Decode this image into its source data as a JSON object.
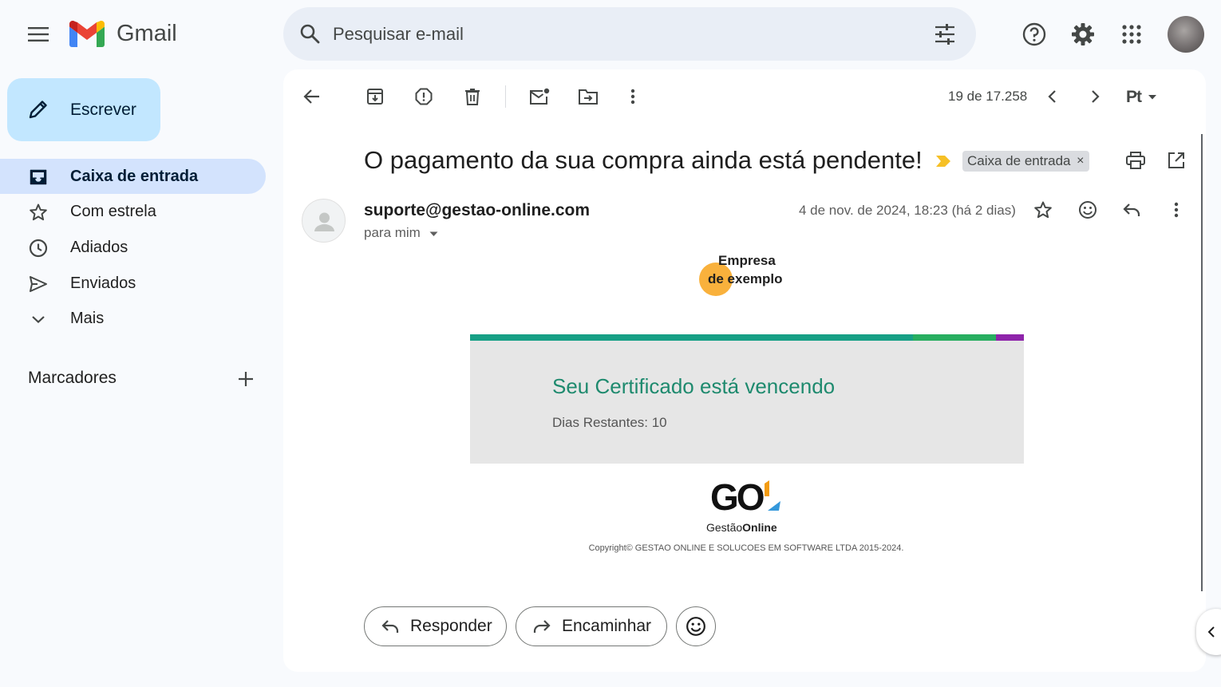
{
  "header": {
    "app_name": "Gmail",
    "search_placeholder": "Pesquisar e-mail"
  },
  "sidebar": {
    "compose_label": "Escrever",
    "items": [
      {
        "label": "Caixa de entrada",
        "icon": "inbox-icon",
        "active": true
      },
      {
        "label": "Com estrela",
        "icon": "star-icon"
      },
      {
        "label": "Adiados",
        "icon": "clock-icon"
      },
      {
        "label": "Enviados",
        "icon": "send-icon"
      },
      {
        "label": "Mais",
        "icon": "chevron-down-icon"
      }
    ],
    "labels_title": "Marcadores"
  },
  "toolbar": {
    "pagination": "19 de 17.258",
    "input_tool": "Pt"
  },
  "message": {
    "subject": "O pagamento da sua compra ainda está pendente!",
    "label_tag": "Caixa de entrada",
    "label_tag_close": "×",
    "sender": "suporte@gestao-online.com",
    "recipient": "para mim",
    "date": "4 de nov. de 2024, 18:23 (há 2 dias)"
  },
  "email_body": {
    "logo_line1": "Empresa",
    "logo_line2": "de exemplo",
    "card_title": "Seu Certificado está vencendo",
    "card_days": "Dias Restantes: 10",
    "footer_logo_text": "GO",
    "footer_logo_sub_a": "Gestão",
    "footer_logo_sub_b": "Online",
    "copyright": "Copyright© GESTAO ONLINE E SOLUCOES EM SOFTWARE LTDA 2015-2024."
  },
  "actions": {
    "reply": "Responder",
    "forward": "Encaminhar"
  },
  "colors": {
    "compose_bg": "#c2e7ff",
    "active_nav_bg": "#d3e3fd",
    "search_bg": "#e9eef6",
    "card_title": "#1e8a6e",
    "stripe_teal": "#16a085",
    "stripe_green": "#27ae60",
    "stripe_purple": "#8e24aa",
    "logo_orange": "#f9b13c",
    "important_marker": "#f6c026"
  }
}
